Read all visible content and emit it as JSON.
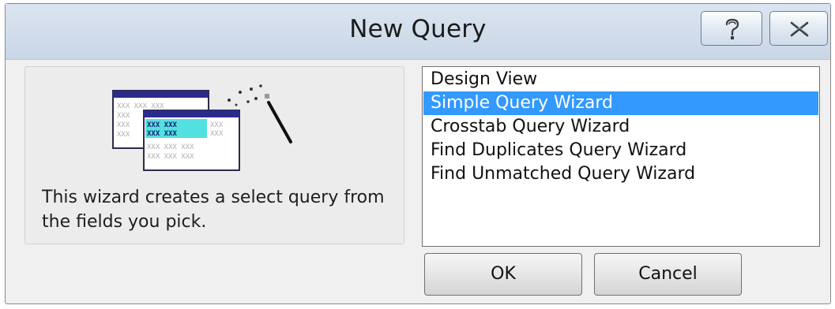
{
  "dialog": {
    "title": "New Query",
    "help_icon": "question-mark-icon",
    "close_icon": "close-x-icon"
  },
  "left_panel": {
    "illustration_icon": "query-wizard-icon",
    "description": "This wizard creates a select query from the fields you pick."
  },
  "query_types": [
    {
      "label": "Design View",
      "selected": false
    },
    {
      "label": "Simple Query Wizard",
      "selected": true
    },
    {
      "label": "Crosstab Query Wizard",
      "selected": false
    },
    {
      "label": "Find Duplicates Query Wizard",
      "selected": false
    },
    {
      "label": "Find Unmatched Query Wizard",
      "selected": false
    }
  ],
  "buttons": {
    "ok": "OK",
    "cancel": "Cancel"
  },
  "colors": {
    "selection": "#3399ff",
    "titlebar": "#dbe5f1"
  }
}
